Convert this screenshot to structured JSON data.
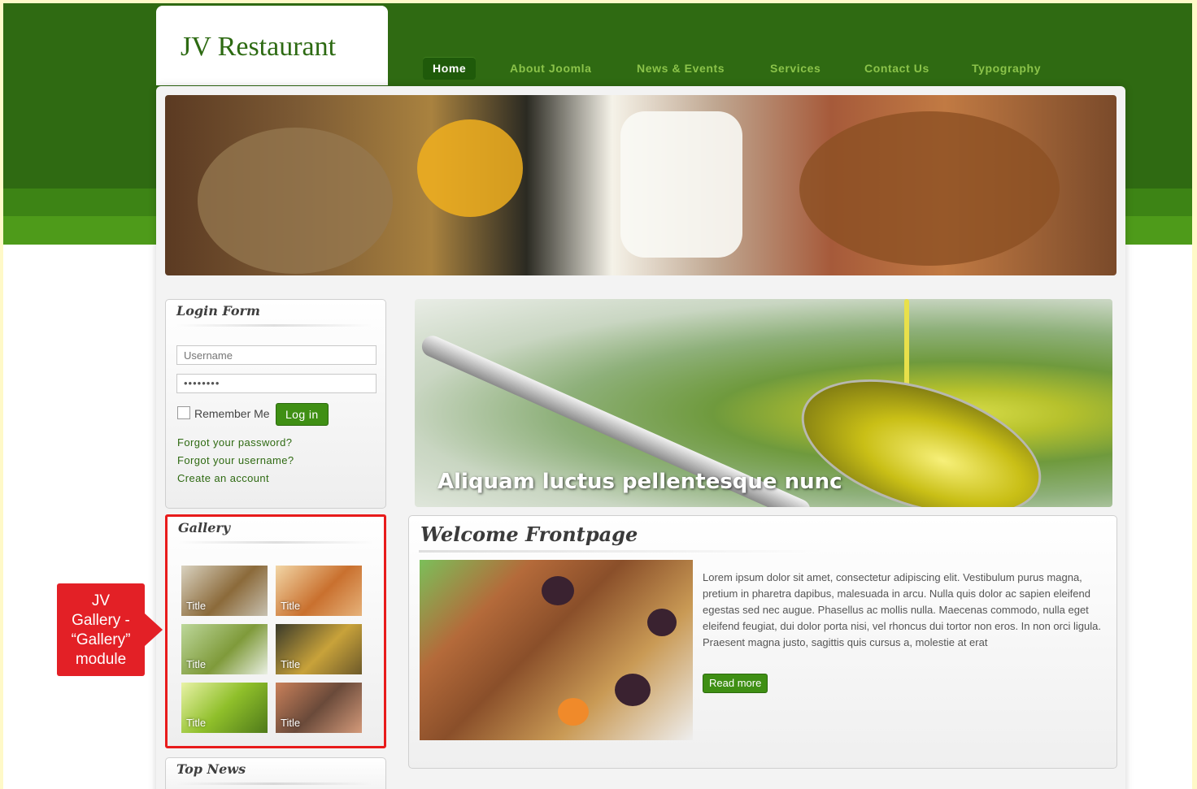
{
  "site": {
    "logo_text": "JV Restaurant"
  },
  "nav": {
    "items": [
      "Home",
      "About Joomla",
      "News & Events",
      "Services",
      "Contact Us",
      "Typography"
    ],
    "active": "Home"
  },
  "login": {
    "title": "Login Form",
    "username_placeholder": "Username",
    "password_mask": "••••••••",
    "remember_label": "Remember Me",
    "login_button": "Log in",
    "forgot_password": "Forgot your password?",
    "forgot_username": "Forgot your username?",
    "create_account": "Create an account"
  },
  "gallery": {
    "title": "Gallery",
    "thumbs": [
      {
        "caption": "Title"
      },
      {
        "caption": "Title"
      },
      {
        "caption": "Title"
      },
      {
        "caption": "Title"
      },
      {
        "caption": "Title"
      },
      {
        "caption": "Title"
      }
    ]
  },
  "top_news": {
    "title": "Top News"
  },
  "slideshow": {
    "caption": "Aliquam luctus pellentesque nunc"
  },
  "article": {
    "title": "Welcome Frontpage",
    "body": "Lorem ipsum dolor sit amet, consectetur adipiscing elit. Vestibulum purus magna, pretium in pharetra dapibus, malesuada in arcu. Nulla quis dolor ac sapien eleifend egestas sed nec augue. Phasellus ac mollis nulla. Maecenas commodo, nulla eget eleifend feugiat, dui dolor porta nisi, vel rhoncus dui tortor non eros. In non orci ligula. Praesent magna justo, sagittis quis cursus a, molestie at erat",
    "read_more": "Read more"
  },
  "annotation": {
    "lines": [
      "JV",
      "Gallery -",
      "“Gallery”",
      "module"
    ]
  },
  "colors": {
    "header_dark": "#2f6a12",
    "accent_green": "#3f8f14",
    "highlight_red": "#e81b1b",
    "outer_bg": "#fff9c8"
  }
}
